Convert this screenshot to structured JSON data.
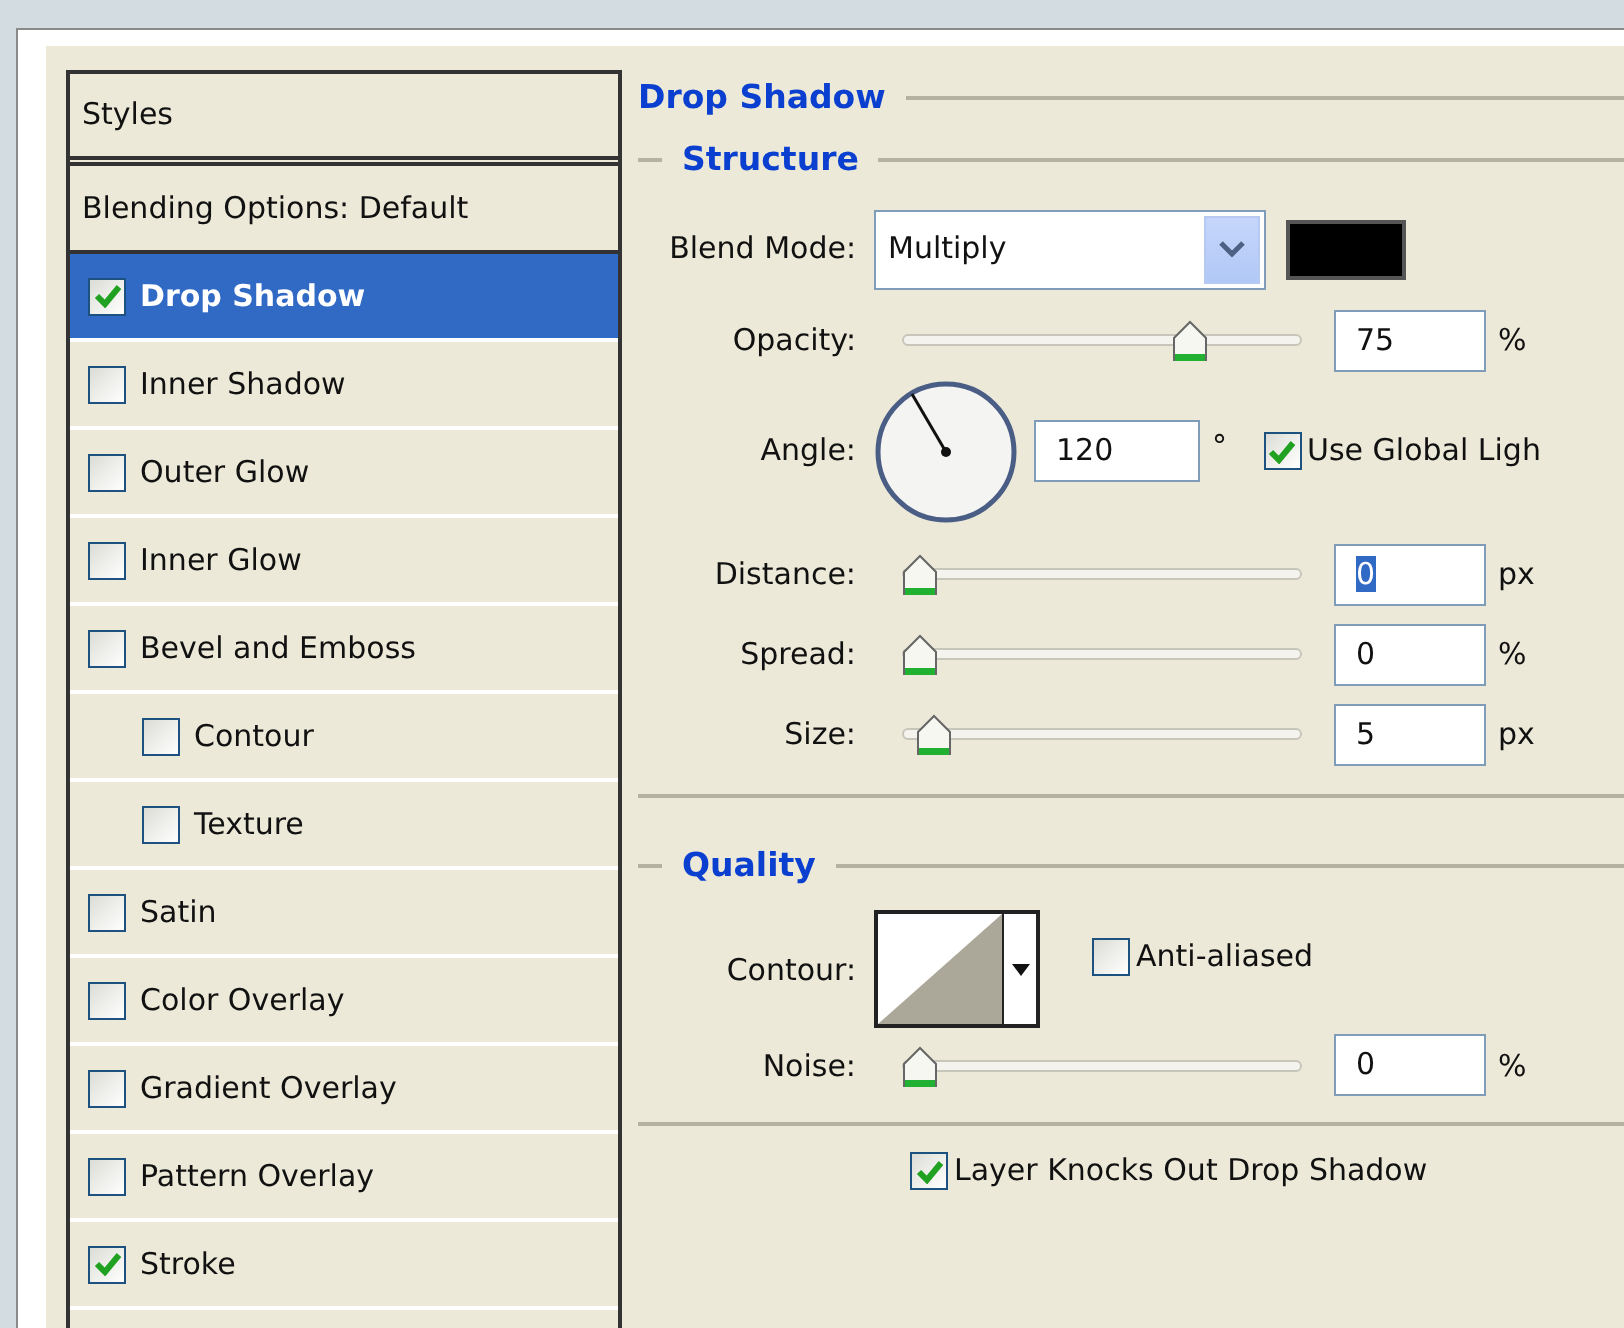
{
  "styles_panel": {
    "header": "Styles",
    "blending_options": "Blending Options: Default",
    "items": [
      {
        "label": "Drop Shadow",
        "checked": true,
        "selected": true
      },
      {
        "label": "Inner Shadow",
        "checked": false,
        "selected": false
      },
      {
        "label": "Outer Glow",
        "checked": false,
        "selected": false
      },
      {
        "label": "Inner Glow",
        "checked": false,
        "selected": false
      },
      {
        "label": "Bevel and Emboss",
        "checked": false,
        "selected": false,
        "children": [
          {
            "label": "Contour",
            "checked": false,
            "selected": false
          },
          {
            "label": "Texture",
            "checked": false,
            "selected": false
          }
        ]
      },
      {
        "label": "Satin",
        "checked": false,
        "selected": false
      },
      {
        "label": "Color Overlay",
        "checked": false,
        "selected": false
      },
      {
        "label": "Gradient Overlay",
        "checked": false,
        "selected": false
      },
      {
        "label": "Pattern Overlay",
        "checked": false,
        "selected": false
      },
      {
        "label": "Stroke",
        "checked": true,
        "selected": false
      }
    ]
  },
  "drop_shadow": {
    "title": "Drop Shadow",
    "structure": {
      "title": "Structure",
      "blend_mode": {
        "label": "Blend Mode:",
        "value": "Multiply",
        "color": "#000000"
      },
      "opacity": {
        "label": "Opacity:",
        "level": 0.74,
        "value": "75",
        "unit": "%",
        "value_selected": false
      },
      "angle": {
        "label": "Angle:",
        "value": "120",
        "unit": "°"
      },
      "global_light": {
        "label": "Use Global Ligh",
        "checked": true
      },
      "sliders": [
        {
          "label": "Distance:",
          "level": 0,
          "value": "0",
          "unit": "px",
          "value_selected": true
        },
        {
          "label": "Spread:",
          "level": 0,
          "value": "0",
          "unit": "%",
          "value_selected": false
        },
        {
          "label": "Size:",
          "level": 0.04,
          "value": "5",
          "unit": "px",
          "value_selected": false
        }
      ]
    },
    "quality": {
      "title": "Quality",
      "contour": {
        "label": "Contour:"
      },
      "anti_aliased": {
        "label": "Anti-aliased",
        "checked": false
      },
      "noise": {
        "label": "Noise:",
        "level": 0,
        "value": "0",
        "unit": "%",
        "value_selected": false
      }
    },
    "knockout": {
      "label": "Layer Knocks Out Drop Shadow",
      "checked": true
    }
  }
}
